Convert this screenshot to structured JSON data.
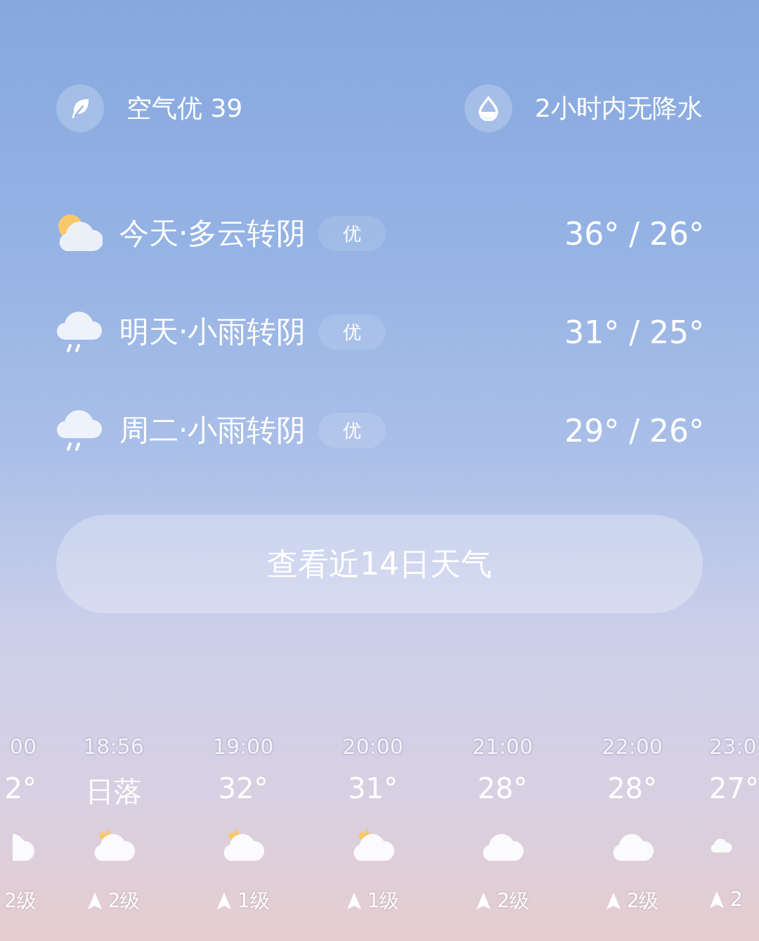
{
  "summary": [
    {
      "kind": "air",
      "text": "空气优 39"
    },
    {
      "kind": "rain",
      "text": "2小时内无降水"
    }
  ],
  "forecast": [
    {
      "kind": "sun-cloud",
      "label": "今天·多云转阴",
      "aqi": "优",
      "temps": "36° / 26°"
    },
    {
      "kind": "rain",
      "label": "明天·小雨转阴",
      "aqi": "优",
      "temps": "31° / 25°"
    },
    {
      "kind": "rain",
      "label": "周二·小雨转阴",
      "aqi": "优",
      "temps": "29° / 26°"
    }
  ],
  "more_button": "查看近14日天气",
  "hourly": [
    {
      "time": "00",
      "temp": "2°",
      "kind": "sun-cloud",
      "wind": "2级"
    },
    {
      "time": "18:56",
      "temp": "日落",
      "kind": "sun-cloud",
      "wind": "2级"
    },
    {
      "time": "19:00",
      "temp": "32°",
      "kind": "sun-cloud",
      "wind": "1级"
    },
    {
      "time": "20:00",
      "temp": "31°",
      "kind": "sun-cloud",
      "wind": "1级"
    },
    {
      "time": "21:00",
      "temp": "28°",
      "kind": "cloud",
      "wind": "2级"
    },
    {
      "time": "22:00",
      "temp": "28°",
      "kind": "cloud",
      "wind": "2级"
    },
    {
      "time": "23:0",
      "temp": "27°",
      "kind": "cloud",
      "wind": "2"
    }
  ]
}
